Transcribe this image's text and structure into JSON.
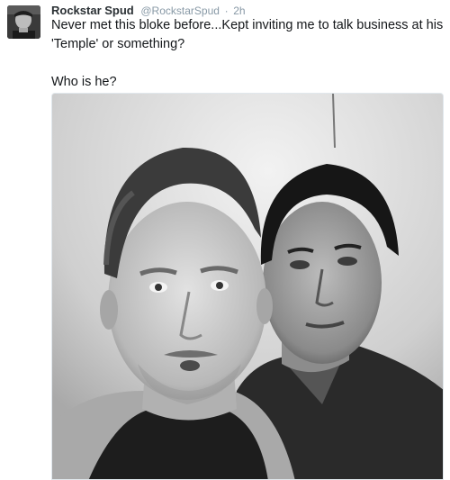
{
  "tweet": {
    "display_name": "Rockstar Spud",
    "handle": "@RockstarSpud",
    "separator": "·",
    "time": "2h",
    "text_line1": "Never met this bloke before...Kept inviting me to talk business at his",
    "text_line2": "'Temple' or something?",
    "text_line3": "",
    "text_line4": "Who is he?",
    "photo_icon": "selfie-photo",
    "avatar_icon": "profile-avatar"
  },
  "colors": {
    "name": "#292f33",
    "meta": "#8899a6",
    "text": "#14171a",
    "border": "#e1e8ed"
  }
}
